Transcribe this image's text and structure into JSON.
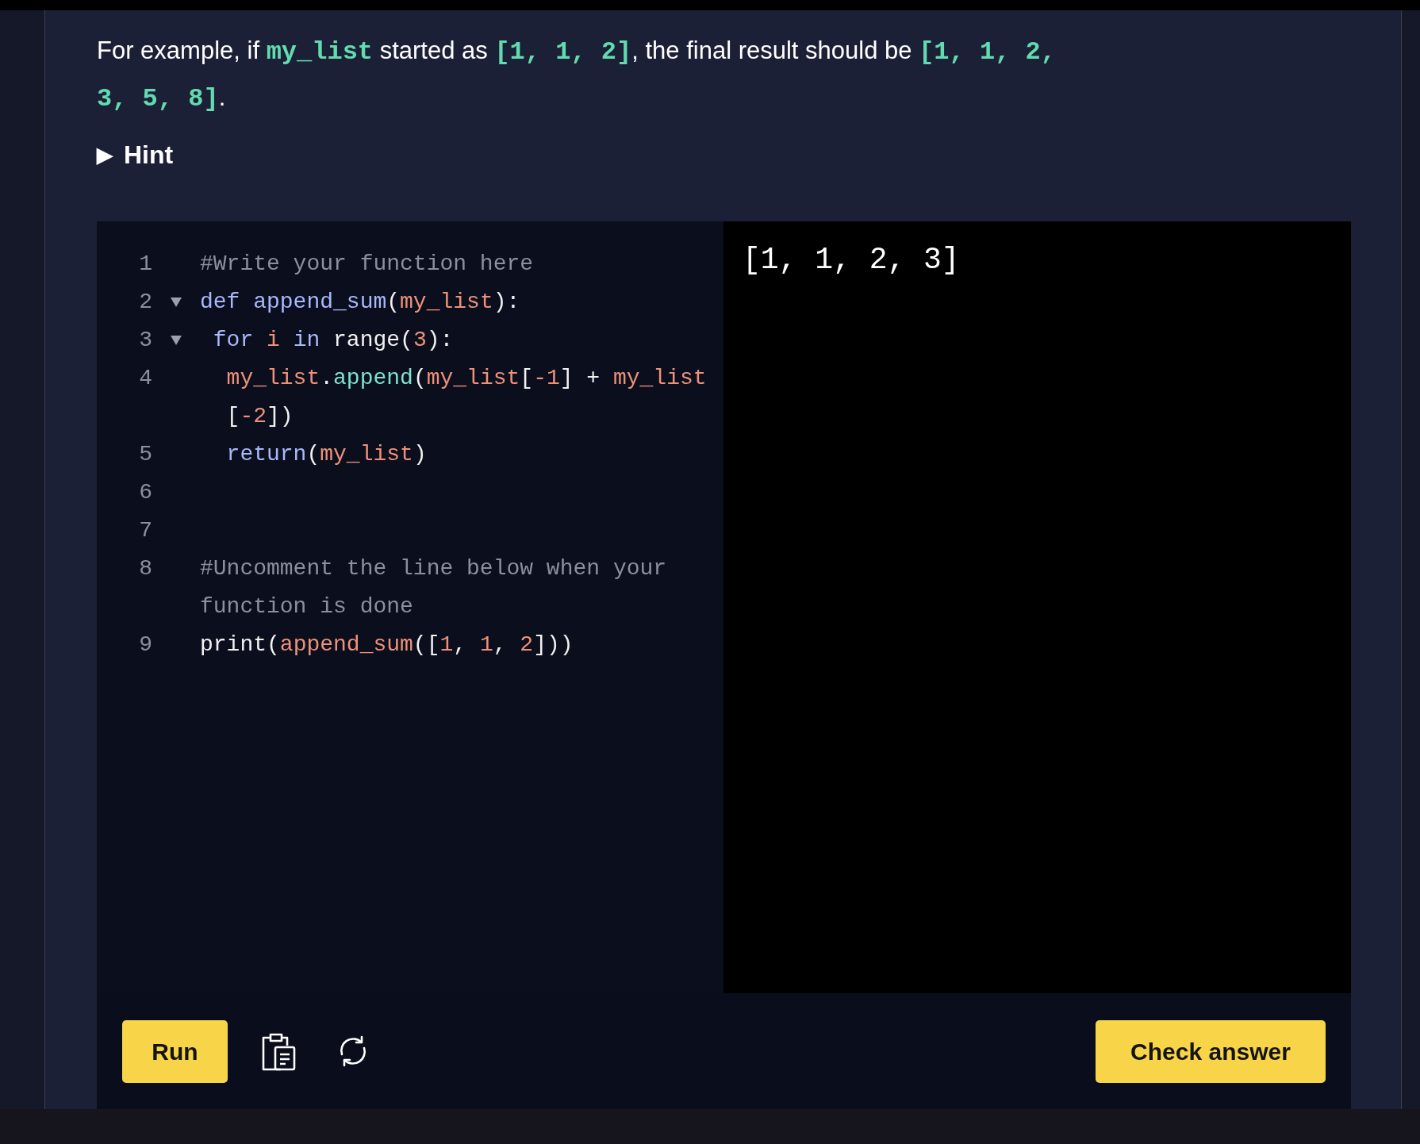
{
  "instructions": [
    {
      "kind": "text",
      "text": "For example, if "
    },
    {
      "kind": "code",
      "text": "my_list"
    },
    {
      "kind": "text",
      "text": " started as "
    },
    {
      "kind": "code",
      "text": "[1, 1, 2]"
    },
    {
      "kind": "text",
      "text": ", the final result should be "
    },
    {
      "kind": "code",
      "text": "[1, 1, 2, 3, 5, 8]"
    },
    {
      "kind": "text",
      "text": "."
    }
  ],
  "hint": {
    "arrow": "▶",
    "label": "Hint",
    "expanded": false
  },
  "editor": {
    "lines": [
      {
        "number": "1",
        "foldable": false,
        "tokens": [
          {
            "kind": "comment",
            "text": "#Write your function here"
          }
        ]
      },
      {
        "number": "2",
        "foldable": true,
        "tokens": [
          {
            "kind": "keyword",
            "text": "def append_sum"
          },
          {
            "kind": "plain",
            "text": "("
          },
          {
            "kind": "variable",
            "text": "my_list"
          },
          {
            "kind": "plain",
            "text": "):"
          }
        ]
      },
      {
        "number": "3",
        "foldable": true,
        "tokens": [
          {
            "kind": "keyword",
            "text": " for "
          },
          {
            "kind": "variable",
            "text": "i"
          },
          {
            "kind": "keyword",
            "text": " in"
          },
          {
            "kind": "plain",
            "text": " range("
          },
          {
            "kind": "number",
            "text": "3"
          },
          {
            "kind": "plain",
            "text": "):"
          }
        ]
      },
      {
        "number": "4",
        "foldable": false,
        "tokens": [
          {
            "kind": "variable",
            "text": "  my_list"
          },
          {
            "kind": "plain",
            "text": "."
          },
          {
            "kind": "method",
            "text": "append"
          },
          {
            "kind": "plain",
            "text": "("
          },
          {
            "kind": "variable",
            "text": "my_list"
          },
          {
            "kind": "plain",
            "text": "["
          },
          {
            "kind": "number",
            "text": "-1"
          },
          {
            "kind": "plain",
            "text": "] + "
          },
          {
            "kind": "variable",
            "text": "my_list"
          },
          {
            "kind": "plain",
            "text": " ["
          },
          {
            "kind": "number",
            "text": "-2"
          },
          {
            "kind": "plain",
            "text": "])"
          }
        ]
      },
      {
        "number": "5",
        "foldable": false,
        "tokens": [
          {
            "kind": "keyword",
            "text": "  return"
          },
          {
            "kind": "plain",
            "text": "("
          },
          {
            "kind": "variable",
            "text": "my_list"
          },
          {
            "kind": "plain",
            "text": ")"
          }
        ]
      },
      {
        "number": "6",
        "foldable": false
      },
      {
        "number": "7",
        "foldable": false
      },
      {
        "number": "8",
        "foldable": false,
        "tokens": [
          {
            "kind": "comment",
            "text": "#Uncomment the line below when your function is done"
          }
        ]
      },
      {
        "number": "9",
        "foldable": false,
        "tokens": [
          {
            "kind": "plain",
            "text": "print("
          },
          {
            "kind": "variable",
            "text": "append_sum"
          },
          {
            "kind": "plain",
            "text": "(["
          },
          {
            "kind": "number",
            "text": "1"
          },
          {
            "kind": "plain",
            "text": ", "
          },
          {
            "kind": "number",
            "text": "1"
          },
          {
            "kind": "plain",
            "text": ", "
          },
          {
            "kind": "number",
            "text": "2"
          },
          {
            "kind": "plain",
            "text": "]))"
          }
        ]
      }
    ]
  },
  "output": "[1, 1, 2, 3]",
  "buttons": {
    "run": "Run",
    "check": "Check answer"
  }
}
